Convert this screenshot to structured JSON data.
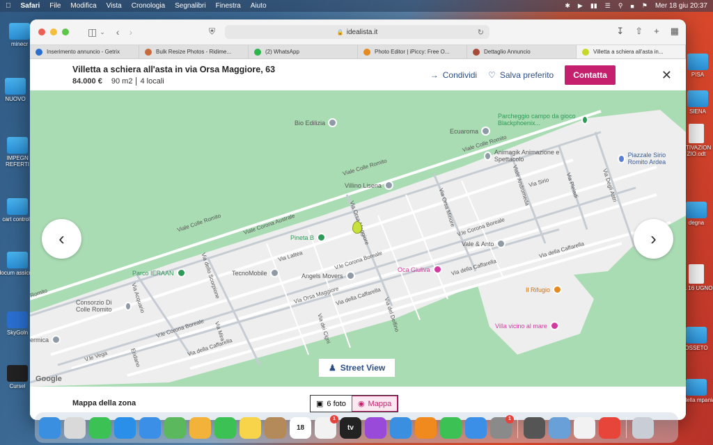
{
  "menubar": {
    "app": "Safari",
    "menus": [
      "File",
      "Modifica",
      "Vista",
      "Cronologia",
      "Segnalibri",
      "Finestra",
      "Aiuto"
    ],
    "datetime": "Mer 18 giu  20:37"
  },
  "desktop": {
    "items": [
      {
        "label": "minecr"
      },
      {
        "label": "NUOVO"
      },
      {
        "label": "IMPEGN REFERTI"
      },
      {
        "label": "cart controll."
      },
      {
        "label": "docum assicura"
      },
      {
        "label": "SkyGoln"
      },
      {
        "label": "Cursel"
      },
      {
        "label": "PISA"
      },
      {
        "label": "SIENA"
      },
      {
        "label": "OTIVAZION ZIO.odt"
      },
      {
        "label": "degna"
      },
      {
        "label": "AL 16 UGNO"
      },
      {
        "label": "OSSETO"
      },
      {
        "label": "te della mpania"
      }
    ]
  },
  "browser": {
    "url": "idealista.it",
    "tabs": [
      {
        "label": "Inserimento annuncio - Getrix",
        "color": "#2a6fd0"
      },
      {
        "label": "Bulk Resize Photos - Ridime...",
        "color": "#c96a3c"
      },
      {
        "label": "(2) WhatsApp",
        "color": "#2bb54a"
      },
      {
        "label": "Photo Editor | iPiccy: Free O...",
        "color": "#e48a1e"
      },
      {
        "label": "Dettaglio Annuncio",
        "color": "#a84a3a"
      },
      {
        "label": "Villetta a schiera all'asta in...",
        "color": "#c8d82a"
      }
    ]
  },
  "listing": {
    "title": "Villetta a schiera all'asta in via Orsa Maggiore, 63",
    "price": "84.000 €",
    "size": "90 m2",
    "rooms": "4 locali",
    "share_label": "Condividi",
    "save_label": "Salva preferito",
    "contact_label": "Contatta"
  },
  "map": {
    "pois": [
      {
        "label": "Bio Edilizia",
        "style": "grey"
      },
      {
        "label": "Ecuaroma",
        "style": "grey"
      },
      {
        "label": "Parcheggio campo da gioco Blackphoenix...",
        "style": "green"
      },
      {
        "label": "Animagik Animazione e Spettacolo",
        "style": "grey"
      },
      {
        "label": "Piazzale Sirio Romito Ardea",
        "style": "blue"
      },
      {
        "label": "Villino Lisena",
        "style": "grey"
      },
      {
        "label": "Pineta B",
        "style": "green"
      },
      {
        "label": "Vale & Anto",
        "style": "grey"
      },
      {
        "label": "Oca Giuliva",
        "style": "pink"
      },
      {
        "label": "Parco IERAAN",
        "style": "green"
      },
      {
        "label": "TecnoMobile",
        "style": "grey"
      },
      {
        "label": "Angels Movers",
        "style": "grey"
      },
      {
        "label": "Il Rifugio",
        "style": "orange"
      },
      {
        "label": "Consorzio Di Colle Romito",
        "style": "grey"
      },
      {
        "label": "Villa vicino al mare",
        "style": "pink"
      },
      {
        "label": "ermica",
        "style": "grey"
      }
    ],
    "streets": [
      "Viale Colle Romito",
      "Viale Colle Romito",
      "Viale Colle Romito",
      "Viale Corona Australe",
      "Via dello Scorpione",
      "Via Orsa Maggiore",
      "V.le Corona Boreale",
      "V.le Corona Boreale",
      "V.le Corona Boreale",
      "Via Orsa Minore",
      "Viale Andromeda",
      "Via Sirio",
      "Via Pleiadi",
      "Via Degli Astri",
      "Via della Caffarella",
      "Via della Caffarella",
      "Via della Caffarella",
      "Via della Caffarella",
      "Via Orsa Maggiore",
      "Via Lattea",
      "Via Acquario",
      "V.le Vega",
      "Eridano",
      "Via del Delfino",
      "Via dei Cigni",
      "Via Mira",
      "Romito"
    ],
    "street_view_label": "Street View",
    "attribution": "Google"
  },
  "footer": {
    "label": "Mappa della zona",
    "photos_label": "6 foto",
    "map_label": "Mappa"
  },
  "dock": {
    "apps": [
      {
        "name": "finder",
        "color": "#3a8fe0"
      },
      {
        "name": "launchpad",
        "color": "#d9d9d9"
      },
      {
        "name": "messages",
        "color": "#3bc154"
      },
      {
        "name": "safari",
        "color": "#2a8fe8"
      },
      {
        "name": "mail",
        "color": "#3b8fe6"
      },
      {
        "name": "maps",
        "color": "#5cb85c"
      },
      {
        "name": "photos",
        "color": "#f3b23a"
      },
      {
        "name": "facetime",
        "color": "#3bc154"
      },
      {
        "name": "notes",
        "color": "#f7d44a"
      },
      {
        "name": "contacts",
        "color": "#b58a5a"
      },
      {
        "name": "calendar",
        "color": "#ffffff",
        "text": "18"
      },
      {
        "name": "reminders",
        "color": "#f2f2f2",
        "badge": "1"
      },
      {
        "name": "tv",
        "color": "#222222",
        "text": "tv"
      },
      {
        "name": "podcasts",
        "color": "#9a4ad8"
      },
      {
        "name": "keynote",
        "color": "#3a8fe0"
      },
      {
        "name": "pages",
        "color": "#f08a1e"
      },
      {
        "name": "numbers",
        "color": "#3bc154"
      },
      {
        "name": "app-store",
        "color": "#3b8fe6"
      },
      {
        "name": "system-preferences",
        "color": "#8a8a8a",
        "badge": "1"
      },
      {
        "name": "keychain",
        "color": "#555555"
      },
      {
        "name": "preview",
        "color": "#6aa0d8"
      },
      {
        "name": "textedit",
        "color": "#f2f2f2"
      },
      {
        "name": "chrome",
        "color": "#e8453a"
      },
      {
        "name": "trash",
        "color": "#c9ced6"
      }
    ]
  }
}
